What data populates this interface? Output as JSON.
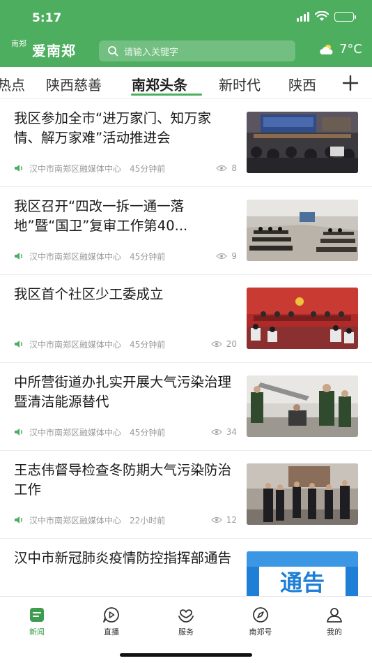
{
  "status": {
    "time": "5:17",
    "battery_level": 1.0
  },
  "app": {
    "logo_seal": "南郑",
    "name": "爱南郑",
    "search_placeholder": "请输入关键字",
    "weather": {
      "icon": "partly-cloudy-icon",
      "temperature": "7°C"
    }
  },
  "tabs": [
    {
      "label": "热点",
      "active": false
    },
    {
      "label": "陕西慈善",
      "active": false
    },
    {
      "label": "南郑头条",
      "active": true
    },
    {
      "label": "新时代",
      "active": false
    },
    {
      "label": "陕西",
      "active": false
    }
  ],
  "accent_color": "#4cae5e",
  "news": [
    {
      "title": "我区参加全市“进万家门、知万家情、解万家难”活动推进会",
      "source": "汉中市南郑区融媒体中心",
      "time": "45分钟前",
      "views": "8",
      "image": "meeting-hall"
    },
    {
      "title": "我区召开“四改一拆一通一落地”暨“国卫”复审工作第40...",
      "source": "汉中市南郑区融媒体中心",
      "time": "45分钟前",
      "views": "9",
      "image": "conference-room"
    },
    {
      "title": "我区首个社区少工委成立",
      "source": "汉中市南郑区融媒体中心",
      "time": "45分钟前",
      "views": "20",
      "image": "ceremony-stage"
    },
    {
      "title": "中所营街道办扎实开展大气污染治理暨清洁能源替代",
      "source": "汉中市南郑区融媒体中心",
      "time": "45分钟前",
      "views": "34",
      "image": "workers-pipe"
    },
    {
      "title": "王志伟督导检查冬防期大气污染防治工作",
      "source": "汉中市南郑区融媒体中心",
      "time": "22小时前",
      "views": "12",
      "image": "inspection-group"
    },
    {
      "title": "汉中市新冠肺炎疫情防控指挥部通告",
      "source": "",
      "time": "",
      "views": "",
      "image": "notice-banner",
      "image_text": "通告"
    }
  ],
  "bottom_nav": [
    {
      "label": "新闻",
      "icon": "news-icon",
      "active": true
    },
    {
      "label": "直播",
      "icon": "live-icon",
      "active": false
    },
    {
      "label": "服务",
      "icon": "service-icon",
      "active": false
    },
    {
      "label": "南郑号",
      "icon": "compass-icon",
      "active": false
    },
    {
      "label": "我的",
      "icon": "profile-icon",
      "active": false
    }
  ]
}
